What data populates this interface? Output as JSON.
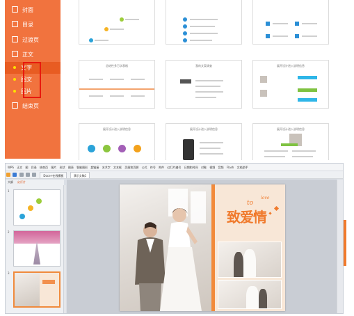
{
  "sidebar": {
    "items": [
      {
        "label": "封面"
      },
      {
        "label": "目录"
      },
      {
        "label": "过渡页"
      },
      {
        "label": "正文"
      },
      {
        "label": "结束页"
      }
    ],
    "sub_items": [
      {
        "label": "文字"
      },
      {
        "label": "图文"
      },
      {
        "label": "图片"
      }
    ]
  },
  "templates": {
    "row2_titles": [
      "总结性多万字表格",
      "我的文案调查",
      "展开设计进入说明信息"
    ],
    "row3_titles": [
      "展开设计进入说明信息",
      "展开设计进入说明信息",
      "展开设计进入说明信息"
    ]
  },
  "app": {
    "menu": [
      "WPS",
      "正文",
      "图",
      "目录",
      "结束页",
      "图片",
      "形状",
      "图表",
      "智能图形",
      "超链接",
      "艺术字",
      "文本框",
      "页眉和页脚",
      "公式",
      "符号",
      "附件",
      "幻灯片编号",
      "日期和时间",
      "对象",
      "视频",
      "音频",
      "Flash",
      "文档助手"
    ],
    "tabs": [
      "Docer-在线模板",
      "演示文稿1"
    ],
    "panel_tabs": [
      "大纲",
      "幻灯片"
    ],
    "slide_numbers": [
      "1",
      "2",
      "3"
    ],
    "slide_text": {
      "title_main": "致爱情",
      "title_to": "to",
      "title_love": "love"
    }
  },
  "colors": {
    "sidebar": "#f1733e",
    "accent": "#f07a2c",
    "selection": "#e8190e"
  }
}
